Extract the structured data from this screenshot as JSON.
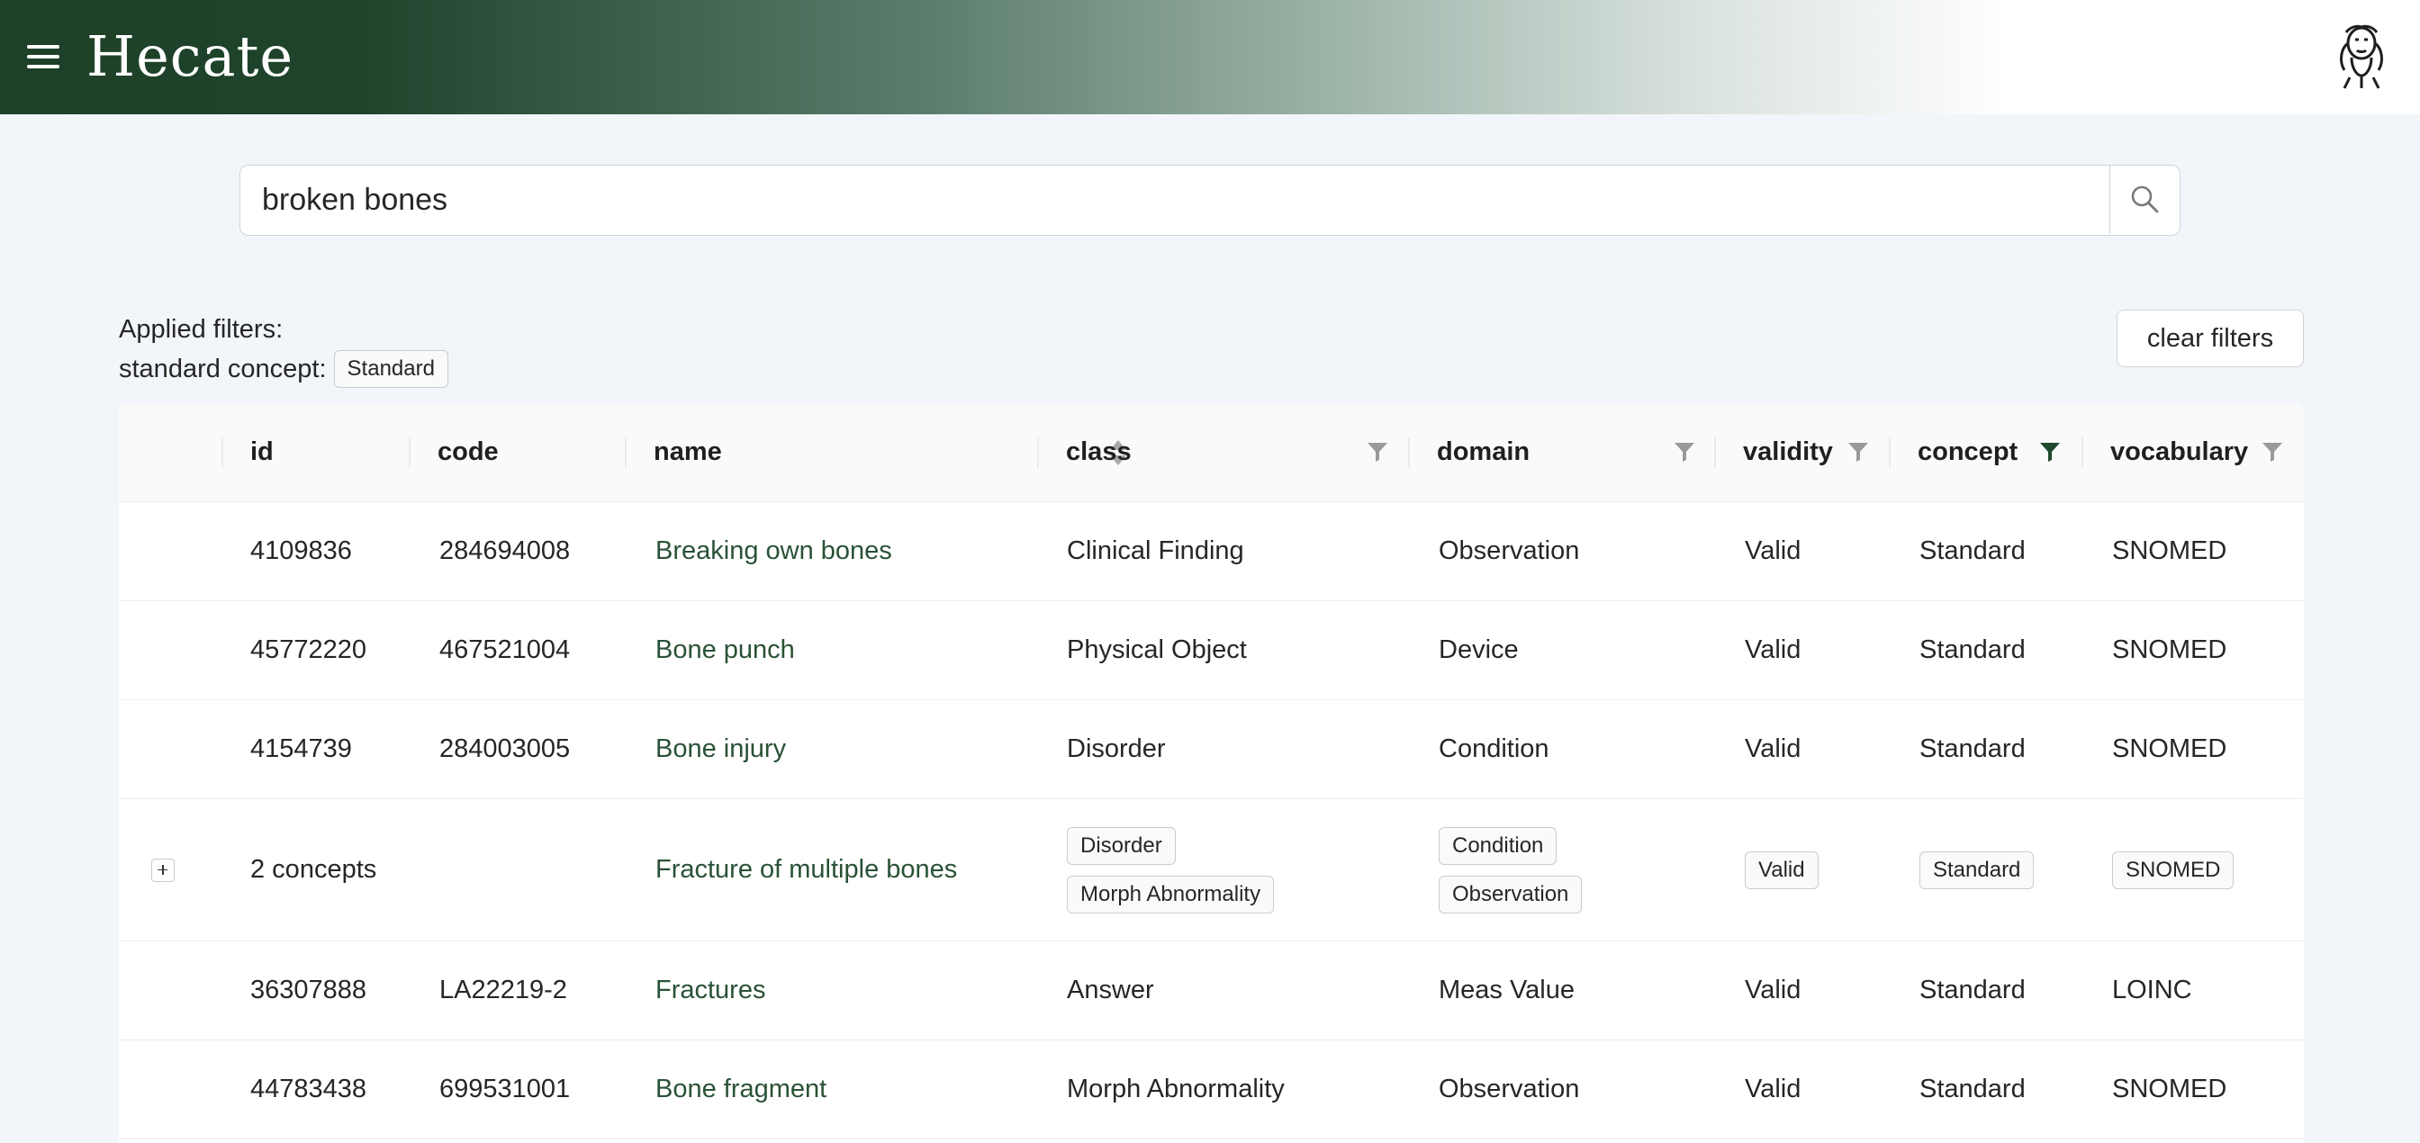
{
  "header": {
    "title": "Hecate",
    "menu_icon": "hamburger-menu-icon",
    "logo_icon": "hecate-logo-icon"
  },
  "search": {
    "value": "broken bones",
    "placeholder": ""
  },
  "filters": {
    "applied_label": "Applied filters:",
    "key": "standard concept:",
    "value": "Standard",
    "clear_label": "clear filters"
  },
  "table": {
    "columns": [
      "id",
      "code",
      "name",
      "class",
      "domain",
      "validity",
      "concept",
      "vocabulary"
    ],
    "rows": [
      {
        "id": "4109836",
        "code": "284694008",
        "name": "Breaking own bones",
        "class": "Clinical Finding",
        "domain": "Observation",
        "validity": "Valid",
        "concept": "Standard",
        "vocabulary": "SNOMED"
      },
      {
        "id": "45772220",
        "code": "467521004",
        "name": "Bone punch",
        "class": "Physical Object",
        "domain": "Device",
        "validity": "Valid",
        "concept": "Standard",
        "vocabulary": "SNOMED"
      },
      {
        "id": "4154739",
        "code": "284003005",
        "name": "Bone injury",
        "class": "Disorder",
        "domain": "Condition",
        "validity": "Valid",
        "concept": "Standard",
        "vocabulary": "SNOMED"
      },
      {
        "id": "2 concepts",
        "code": "",
        "name": "Fracture of multiple bones",
        "class": [
          "Disorder",
          "Morph Abnormality"
        ],
        "domain": [
          "Condition",
          "Observation"
        ],
        "validity": "Valid",
        "concept": "Standard",
        "vocabulary": "SNOMED"
      },
      {
        "id": "36307888",
        "code": "LA22219-2",
        "name": "Fractures",
        "class": "Answer",
        "domain": "Meas Value",
        "validity": "Valid",
        "concept": "Standard",
        "vocabulary": "LOINC"
      },
      {
        "id": "44783438",
        "code": "699531001",
        "name": "Bone fragment",
        "class": "Morph Abnormality",
        "domain": "Observation",
        "validity": "Valid",
        "concept": "Standard",
        "vocabulary": "SNOMED"
      }
    ]
  },
  "colors": {
    "header_dark_green": "#1d4027",
    "link_green": "#2a5236",
    "active_filter_green": "#1f4a2d",
    "inactive_filter_gray": "#9a9a9a"
  }
}
